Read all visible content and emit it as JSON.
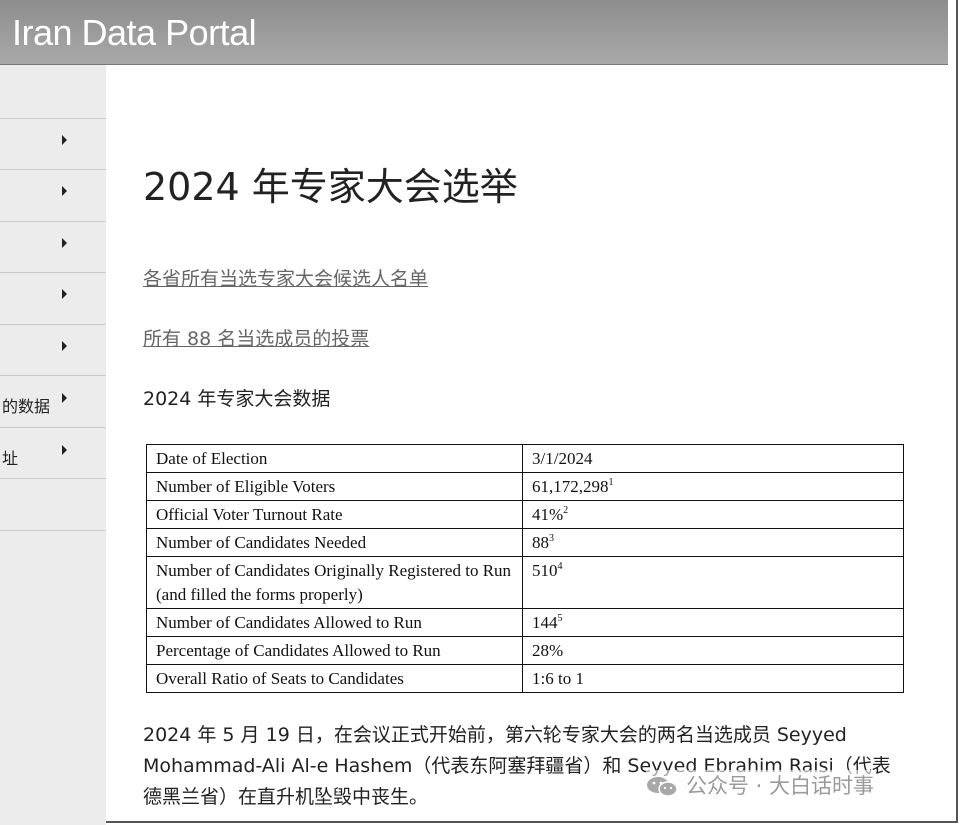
{
  "header": {
    "title": "Iran Data Portal"
  },
  "sidebar": {
    "items": [
      {
        "label": ""
      },
      {
        "label": ""
      },
      {
        "label": ""
      },
      {
        "label": ""
      },
      {
        "label": ""
      },
      {
        "label": ""
      },
      {
        "label": "的数据"
      },
      {
        "label": "址"
      },
      {
        "label": ""
      }
    ]
  },
  "main": {
    "title": "2024 年专家大会选举",
    "links": [
      "各省所有当选专家大会候选人名单",
      "所有 88 名当选成员的投票"
    ],
    "subheading": "2024 年专家大会数据",
    "table": {
      "rows": [
        {
          "key": "Date of Election",
          "value": "3/1/2024",
          "note": ""
        },
        {
          "key": "Number of Eligible Voters",
          "value": "61,172,298",
          "note": "1"
        },
        {
          "key": "Official Voter Turnout Rate",
          "value": "41%",
          "note": "2"
        },
        {
          "key": "Number of Candidates Needed",
          "value": "88",
          "note": "3"
        },
        {
          "key": "Number of Candidates Originally Registered to Run (and filled the forms properly)",
          "value": "510",
          "note": "4"
        },
        {
          "key": "Number of Candidates Allowed to Run",
          "value": "144",
          "note": "5"
        },
        {
          "key": "Percentage of Candidates Allowed to Run",
          "value": "28%",
          "note": ""
        },
        {
          "key": "Overall Ratio of Seats to Candidates",
          "value": "1:6 to 1",
          "note": ""
        }
      ]
    },
    "paragraph": "2024 年 5 月 19 日，在会议正式开始前，第六轮专家大会的两名当选成员 Seyyed Mohammad-Ali Al-e Hashem（代表东阿塞拜疆省）和 Seyyed Ebrahim Raisi（代表德黑兰省）在直升机坠毁中丧生。"
  },
  "watermark": {
    "text": "公众号 · 大白话时事",
    "icon": "wechat-icon"
  },
  "colors": {
    "header_bg": "#999999",
    "sidebar_bg": "#ececec",
    "link": "#666666"
  }
}
